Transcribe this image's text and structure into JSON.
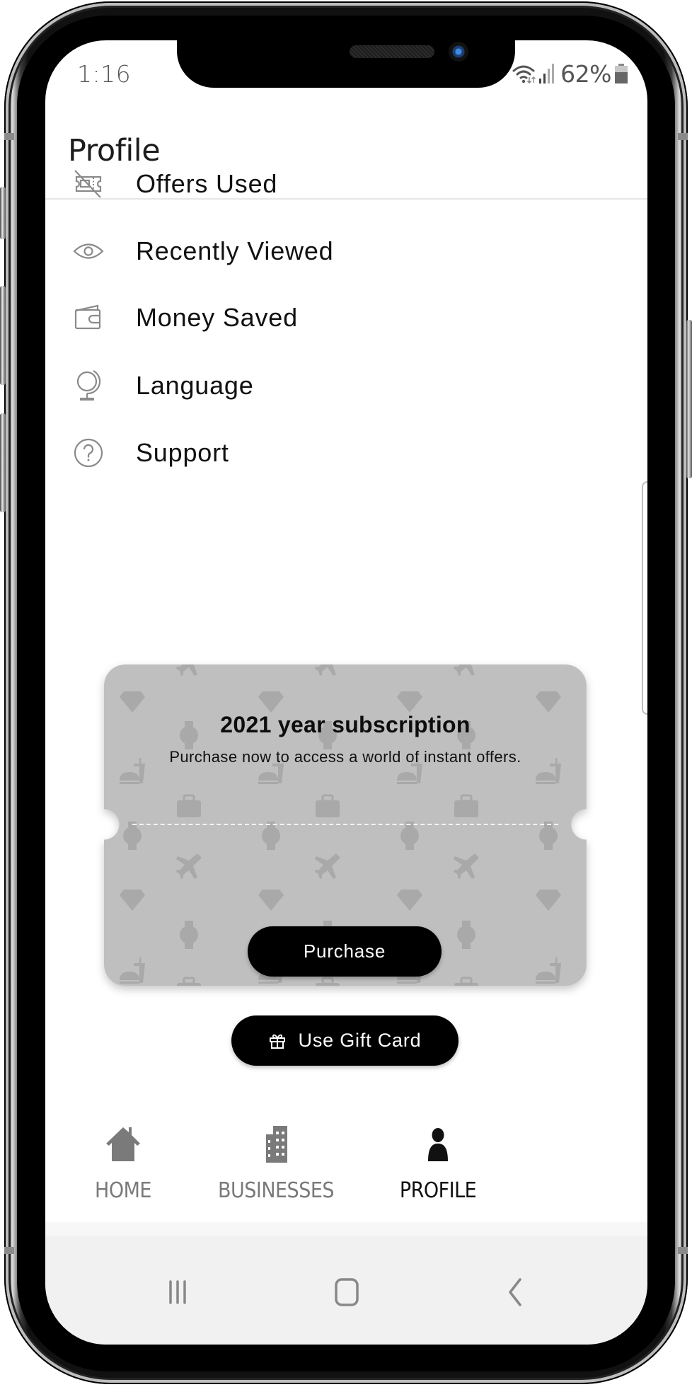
{
  "status_bar": {
    "time": "1:16",
    "battery_percent_label": "62%",
    "battery_level": 0.62,
    "icons": [
      "wifi-icon",
      "signal-icon",
      "battery-icon"
    ]
  },
  "header": {
    "title": "Profile"
  },
  "menu": {
    "items": [
      {
        "label": "Offers Used",
        "icon": "offers-used-icon"
      },
      {
        "label": "Recently Viewed",
        "icon": "eye-icon"
      },
      {
        "label": "Money Saved",
        "icon": "wallet-icon"
      },
      {
        "label": "Language",
        "icon": "globe-icon"
      },
      {
        "label": "Support",
        "icon": "help-circle-icon"
      }
    ]
  },
  "subscription_card": {
    "title": "2021 year subscription",
    "subtitle": "Purchase now to access a world of instant offers.",
    "purchase_label": "Purchase",
    "background_color": "#bfbfbf",
    "pattern_icons": [
      "diamond-icon",
      "watch-icon",
      "fast-food-icon",
      "briefcase-icon",
      "airplane-icon"
    ]
  },
  "gift_card": {
    "label": "Use Gift Card",
    "icon": "gift-icon"
  },
  "tabbar": {
    "tabs": [
      {
        "label": "HOME",
        "icon": "home-icon",
        "active": false
      },
      {
        "label": "BUSINESSES",
        "icon": "building-icon",
        "active": false
      },
      {
        "label": "PROFILE",
        "icon": "person-icon",
        "active": true
      }
    ],
    "active_color": "#111111",
    "inactive_color": "#7a7a7a"
  },
  "system_nav": {
    "buttons": [
      "recent-apps",
      "home",
      "back"
    ]
  }
}
